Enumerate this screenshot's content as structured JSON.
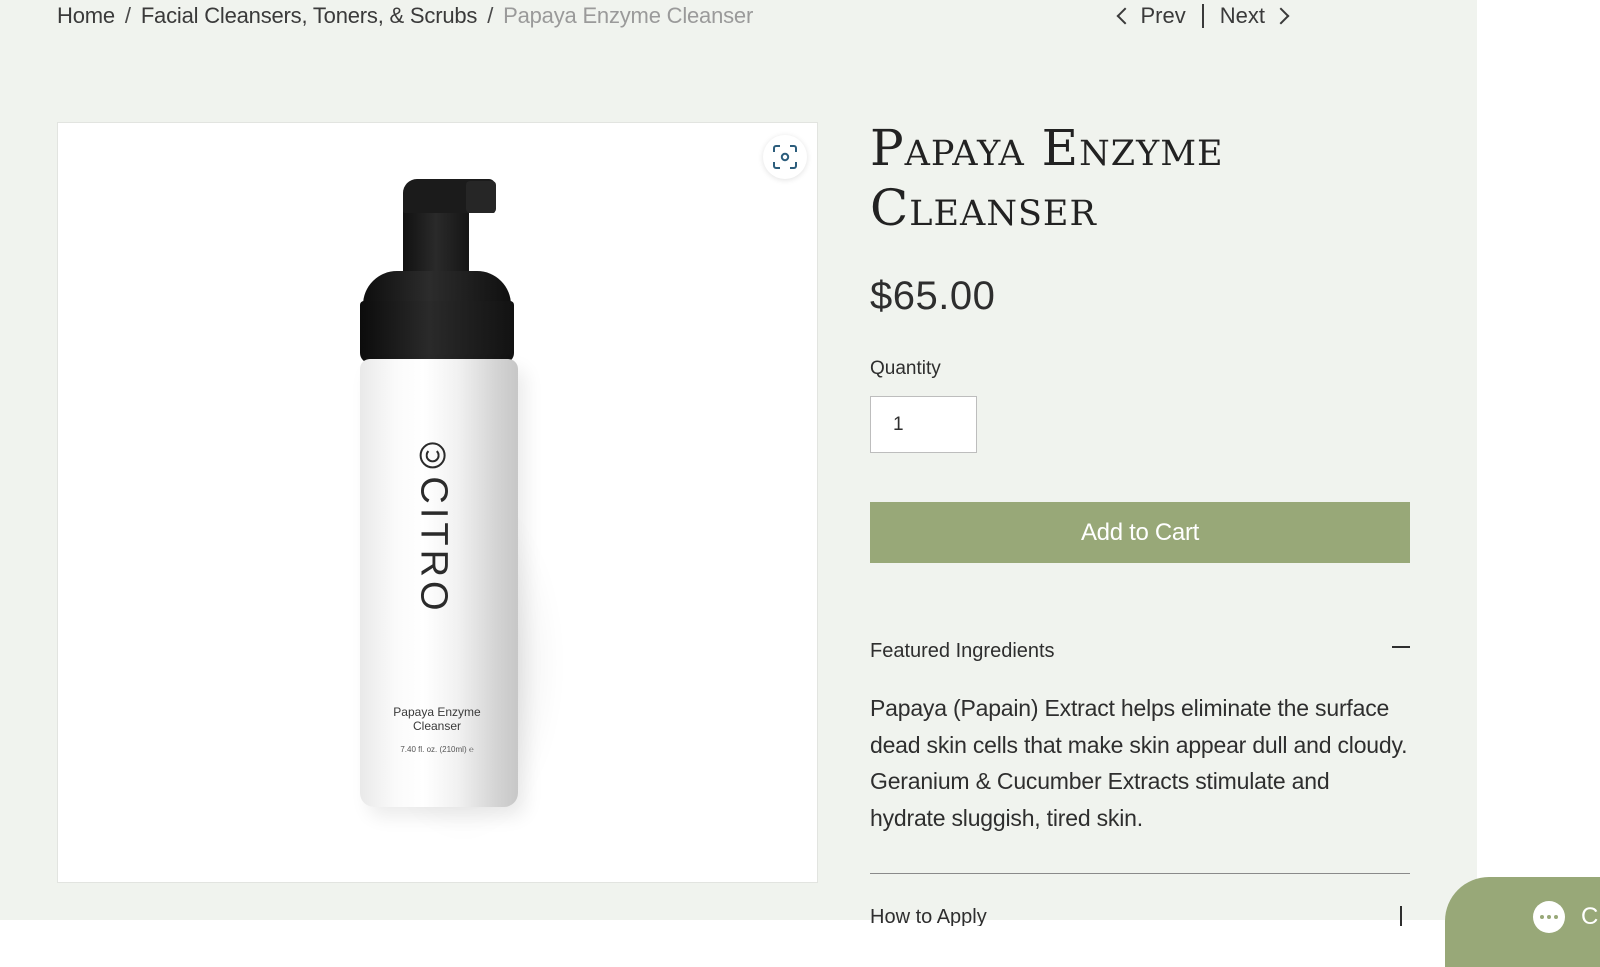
{
  "breadcrumb": {
    "home": "Home",
    "separator": "/",
    "category": "Facial Cleansers, Toners, & Scrubs",
    "current": "Papaya Enzyme Cleanser"
  },
  "pager": {
    "prev": "Prev",
    "next": "Next"
  },
  "product_image": {
    "brand": "CITRO",
    "label_name": "Papaya Enzyme Cleanser",
    "label_volume": "7.40 fl. oz. (210ml) ℮"
  },
  "product": {
    "title": "Papaya Enzyme Cleanser",
    "price": "$65.00",
    "quantity_label": "Quantity",
    "quantity_value": "1",
    "add_to_cart": "Add to Cart"
  },
  "accordion": {
    "featured_title": "Featured Ingredients",
    "featured_body": "Papaya (Papain) Extract helps eliminate the surface dead skin cells that make skin appear dull and cloudy. Geranium & Cucumber Extracts stimulate and hydrate sluggish, tired skin.",
    "next_title": "How to Apply"
  },
  "chat": {
    "letter": "C"
  },
  "colors": {
    "page_background": "#f0f3ee",
    "accent": "#98a878",
    "text": "#2e2e2e",
    "muted_text": "#9a9a9a",
    "icon_accent": "#2c5d7c"
  },
  "icons": {
    "prev": "chevron-left-icon",
    "next": "chevron-right-icon",
    "zoom": "expand-focus-icon",
    "collapse": "minus-icon",
    "expand": "plus-icon",
    "chat": "chat-bubble-icon"
  }
}
